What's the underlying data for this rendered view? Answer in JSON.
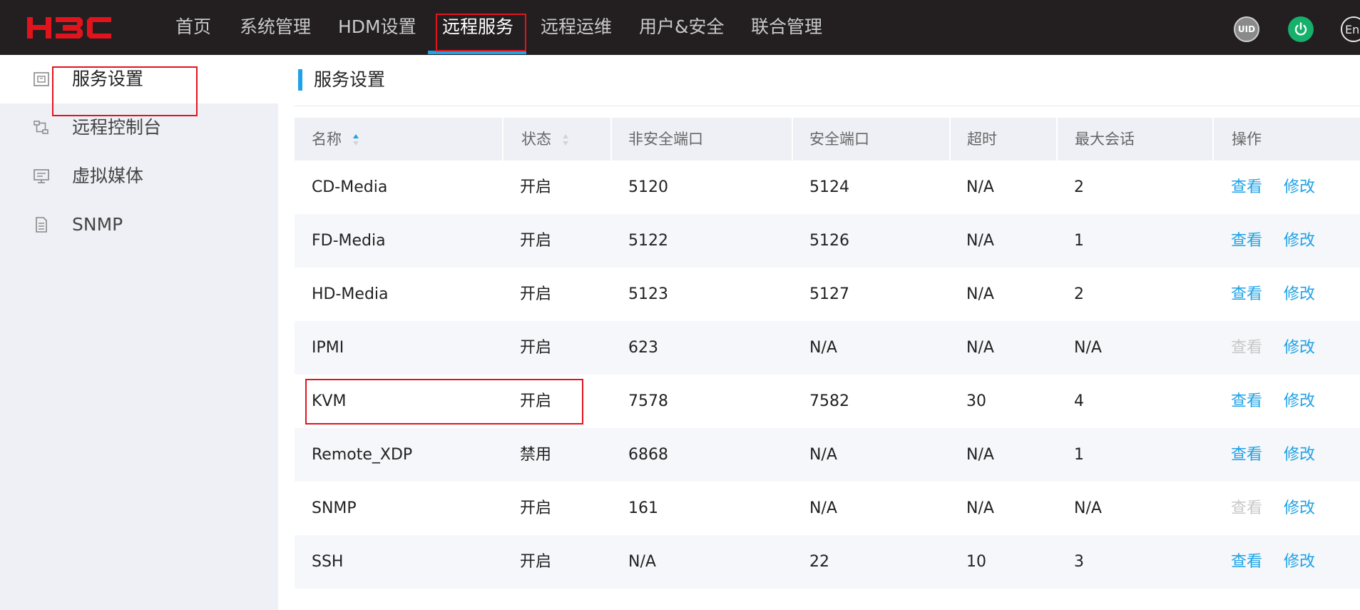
{
  "header": {
    "logo_text": "H3C",
    "nav": [
      {
        "label": "首页"
      },
      {
        "label": "系统管理"
      },
      {
        "label": "HDM设置"
      },
      {
        "label": "远程服务"
      },
      {
        "label": "远程运维"
      },
      {
        "label": "用户&安全"
      },
      {
        "label": "联合管理"
      }
    ],
    "active_nav": "远程服务",
    "icons": {
      "uid_label": "UID",
      "power_icon": "power-icon",
      "language_label": "En"
    },
    "colors": {
      "background": "#231f20",
      "accent": "#1fa2e6",
      "brand_red": "#e1141e"
    }
  },
  "sidebar": {
    "items": [
      {
        "label": "服务设置",
        "icon": "service-settings-icon",
        "active": true
      },
      {
        "label": "远程控制台",
        "icon": "remote-console-icon",
        "active": false
      },
      {
        "label": "虚拟媒体",
        "icon": "virtual-media-icon",
        "active": false
      },
      {
        "label": "SNMP",
        "icon": "snmp-icon",
        "active": false
      }
    ]
  },
  "main": {
    "title": "服务设置",
    "table": {
      "columns": [
        "名称",
        "状态",
        "非安全端口",
        "安全端口",
        "超时",
        "最大会话",
        "操作"
      ],
      "sortable_columns": [
        "名称",
        "状态"
      ],
      "rows": [
        {
          "name": "CD-Media",
          "status": "开启",
          "insecure_port": "5120",
          "secure_port": "5124",
          "timeout": "N/A",
          "max_sessions": "2",
          "view": "查看",
          "edit": "修改",
          "view_enabled": true
        },
        {
          "name": "FD-Media",
          "status": "开启",
          "insecure_port": "5122",
          "secure_port": "5126",
          "timeout": "N/A",
          "max_sessions": "1",
          "view": "查看",
          "edit": "修改",
          "view_enabled": true
        },
        {
          "name": "HD-Media",
          "status": "开启",
          "insecure_port": "5123",
          "secure_port": "5127",
          "timeout": "N/A",
          "max_sessions": "2",
          "view": "查看",
          "edit": "修改",
          "view_enabled": true
        },
        {
          "name": "IPMI",
          "status": "开启",
          "insecure_port": "623",
          "secure_port": "N/A",
          "timeout": "N/A",
          "max_sessions": "N/A",
          "view": "查看",
          "edit": "修改",
          "view_enabled": false
        },
        {
          "name": "KVM",
          "status": "开启",
          "insecure_port": "7578",
          "secure_port": "7582",
          "timeout": "30",
          "max_sessions": "4",
          "view": "查看",
          "edit": "修改",
          "view_enabled": true
        },
        {
          "name": "Remote_XDP",
          "status": "禁用",
          "insecure_port": "6868",
          "secure_port": "N/A",
          "timeout": "N/A",
          "max_sessions": "1",
          "view": "查看",
          "edit": "修改",
          "view_enabled": true
        },
        {
          "name": "SNMP",
          "status": "开启",
          "insecure_port": "161",
          "secure_port": "N/A",
          "timeout": "N/A",
          "max_sessions": "N/A",
          "view": "查看",
          "edit": "修改",
          "view_enabled": false
        },
        {
          "name": "SSH",
          "status": "开启",
          "insecure_port": "N/A",
          "secure_port": "22",
          "timeout": "10",
          "max_sessions": "3",
          "view": "查看",
          "edit": "修改",
          "view_enabled": true
        }
      ]
    }
  }
}
